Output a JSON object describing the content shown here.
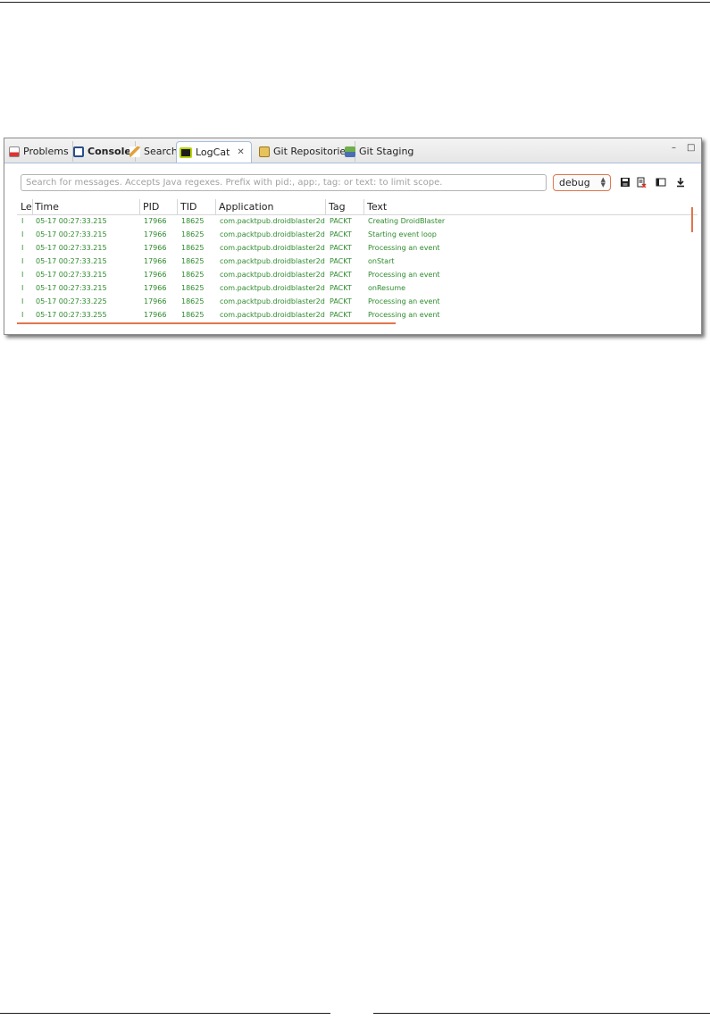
{
  "tabs": [
    {
      "label": "Problems",
      "icon": "problems-icon"
    },
    {
      "label": "Console",
      "icon": "console-icon",
      "bold": true
    },
    {
      "label": "Search",
      "icon": "search-icon"
    },
    {
      "label": "LogCat",
      "icon": "logcat-icon",
      "active": true,
      "close": "✕"
    },
    {
      "label": "Git Repositories",
      "icon": "git-repositories-icon"
    },
    {
      "label": "Git Staging",
      "icon": "git-staging-icon"
    }
  ],
  "window_controls": {
    "minimize": "–",
    "maximize": "□"
  },
  "search": {
    "placeholder": "Search for messages. Accepts Java regexes. Prefix with pid:, app:, tag: or text: to limit scope."
  },
  "log_level": {
    "selected": "debug"
  },
  "columns": [
    "Le",
    "Time",
    "PID",
    "TID",
    "Application",
    "Tag",
    "Text"
  ],
  "rows": [
    {
      "level": "I",
      "time": "05-17 00:27:33.215",
      "pid": "17966",
      "tid": "18625",
      "app": "com.packtpub.droidblaster2d",
      "tag": "PACKT",
      "text": "Creating DroidBlaster"
    },
    {
      "level": "I",
      "time": "05-17 00:27:33.215",
      "pid": "17966",
      "tid": "18625",
      "app": "com.packtpub.droidblaster2d",
      "tag": "PACKT",
      "text": "Starting event loop"
    },
    {
      "level": "I",
      "time": "05-17 00:27:33.215",
      "pid": "17966",
      "tid": "18625",
      "app": "com.packtpub.droidblaster2d",
      "tag": "PACKT",
      "text": "Processing an event"
    },
    {
      "level": "I",
      "time": "05-17 00:27:33.215",
      "pid": "17966",
      "tid": "18625",
      "app": "com.packtpub.droidblaster2d",
      "tag": "PACKT",
      "text": "onStart"
    },
    {
      "level": "I",
      "time": "05-17 00:27:33.215",
      "pid": "17966",
      "tid": "18625",
      "app": "com.packtpub.droidblaster2d",
      "tag": "PACKT",
      "text": "Processing an event"
    },
    {
      "level": "I",
      "time": "05-17 00:27:33.215",
      "pid": "17966",
      "tid": "18625",
      "app": "com.packtpub.droidblaster2d",
      "tag": "PACKT",
      "text": "onResume"
    },
    {
      "level": "I",
      "time": "05-17 00:27:33.225",
      "pid": "17966",
      "tid": "18625",
      "app": "com.packtpub.droidblaster2d",
      "tag": "PACKT",
      "text": "Processing an event"
    },
    {
      "level": "I",
      "time": "05-17 00:27:33.255",
      "pid": "17966",
      "tid": "18625",
      "app": "com.packtpub.droidblaster2d",
      "tag": "PACKT",
      "text": "Processing an event"
    }
  ],
  "colors": {
    "log_info": "#2e8b2e",
    "accent": "#e2754d",
    "tab_border": "#a9bedd"
  }
}
